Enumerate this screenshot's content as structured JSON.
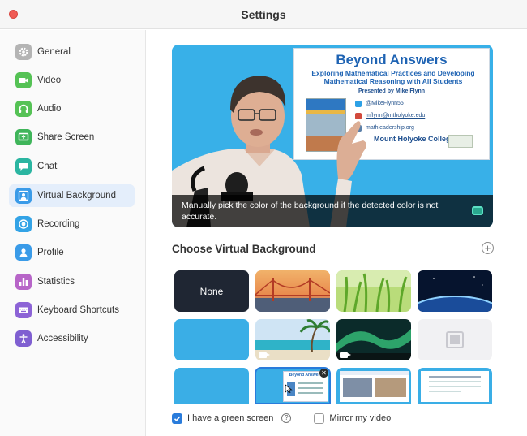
{
  "window": {
    "title": "Settings"
  },
  "sidebar": {
    "items": [
      {
        "label": "General",
        "icon": "gear-icon",
        "color": "#b4b4b4"
      },
      {
        "label": "Video",
        "icon": "video-camera-icon",
        "color": "#55c255"
      },
      {
        "label": "Audio",
        "icon": "headphones-icon",
        "color": "#55c255"
      },
      {
        "label": "Share Screen",
        "icon": "share-screen-icon",
        "color": "#3fb55a"
      },
      {
        "label": "Chat",
        "icon": "chat-bubble-icon",
        "color": "#2bb5a1"
      },
      {
        "label": "Virtual Background",
        "icon": "person-background-icon",
        "color": "#3a9be8"
      },
      {
        "label": "Recording",
        "icon": "record-icon",
        "color": "#33a3e6"
      },
      {
        "label": "Profile",
        "icon": "person-icon",
        "color": "#3a9be8"
      },
      {
        "label": "Statistics",
        "icon": "bar-chart-icon",
        "color": "#b765c8"
      },
      {
        "label": "Keyboard Shortcuts",
        "icon": "keyboard-icon",
        "color": "#8c63d6"
      },
      {
        "label": "Accessibility",
        "icon": "accessibility-icon",
        "color": "#7f5fd1"
      }
    ],
    "active_index": 5
  },
  "preview": {
    "caption": "Manually pick the color of the background if the detected color is not accurate.",
    "slide": {
      "title": "Beyond Answers",
      "subtitle": "Exploring Mathematical Practices and Developing Mathematical Reasoning with All Students",
      "presenter": "Presented by Mike Flynn",
      "twitter": "@MikeFlynn55",
      "email": "mflynn@mtholyoke.edu",
      "website": "mathleadership.org",
      "org": "Mount Holyoke College"
    }
  },
  "backgrounds": {
    "heading": "Choose Virtual Background",
    "none_label": "None",
    "items": [
      "None",
      "Golden Gate Bridge",
      "Grass",
      "Earth from space",
      "Blue",
      "Beach",
      "Aurora",
      "Video placeholder",
      "Blue",
      "Beyond Answers slide",
      "Classroom slide",
      "Slide"
    ]
  },
  "options": {
    "green_screen_label": "I have a green screen",
    "green_screen_checked": true,
    "mirror_label": "Mirror my video",
    "mirror_checked": false
  },
  "colors": {
    "accent": "#2a7cdb",
    "preview_background": "#38b0e8"
  }
}
